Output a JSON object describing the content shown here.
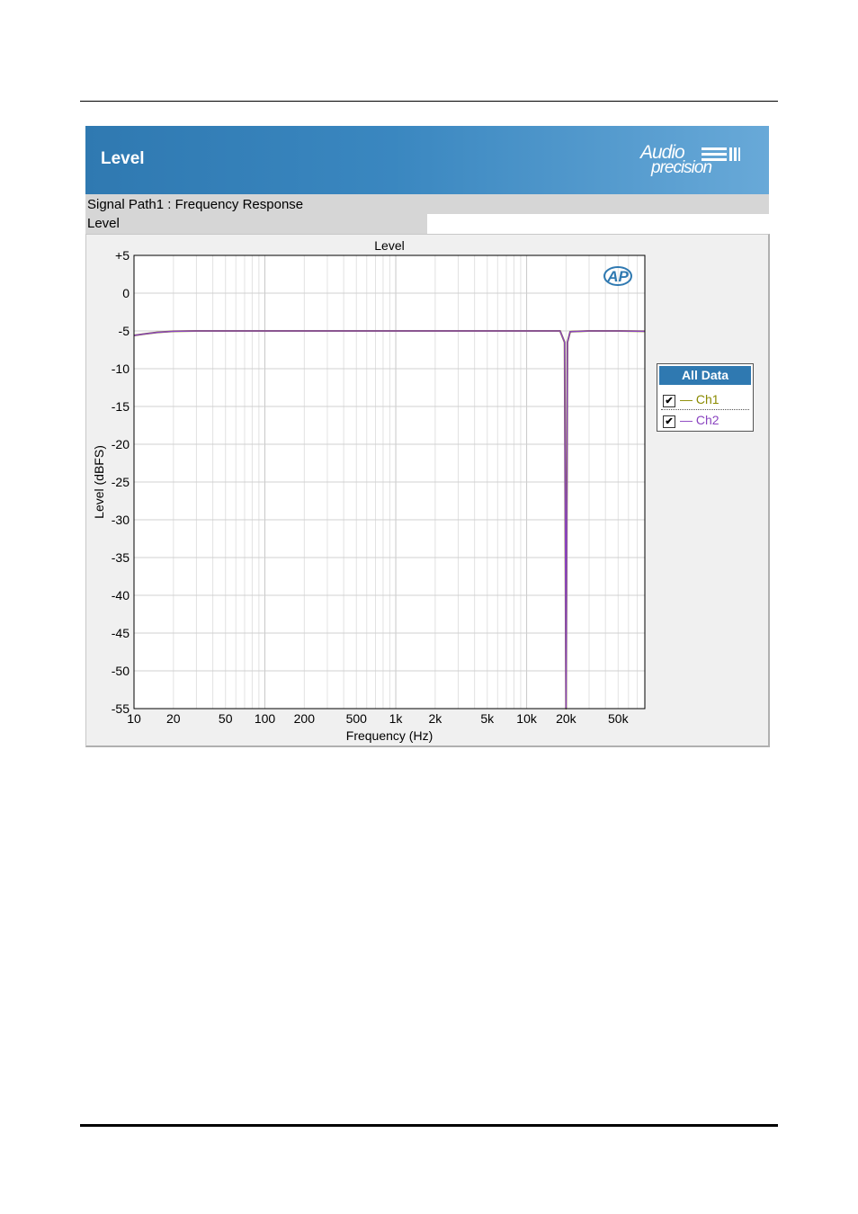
{
  "header": {
    "banner_title": "Level",
    "logo_text_1": "Audio",
    "logo_text_2": "precision",
    "signal_path": "Signal Path1 : Frequency Response",
    "measurement": "Level"
  },
  "legend": {
    "title": "All Data",
    "items": [
      {
        "label": "— Ch1",
        "color": "#8a8a00",
        "checked": true
      },
      {
        "label": "— Ch2",
        "color": "#8a44c0",
        "checked": true
      }
    ]
  },
  "watermark": "AP",
  "chart_data": {
    "type": "line",
    "title": "Level",
    "xlabel": "Frequency (Hz)",
    "ylabel": "Level (dBFS)",
    "x_scale": "log",
    "xlim": [
      10,
      80000
    ],
    "ylim": [
      -55,
      5
    ],
    "grid": true,
    "legend_position": "right",
    "x_ticks": [
      {
        "v": 10,
        "label": "10"
      },
      {
        "v": 20,
        "label": "20"
      },
      {
        "v": 50,
        "label": "50"
      },
      {
        "v": 100,
        "label": "100"
      },
      {
        "v": 200,
        "label": "200"
      },
      {
        "v": 500,
        "label": "500"
      },
      {
        "v": 1000,
        "label": "1k"
      },
      {
        "v": 2000,
        "label": "2k"
      },
      {
        "v": 5000,
        "label": "5k"
      },
      {
        "v": 10000,
        "label": "10k"
      },
      {
        "v": 20000,
        "label": "20k"
      },
      {
        "v": 50000,
        "label": "50k"
      }
    ],
    "y_ticks": [
      {
        "v": 5,
        "label": "+5"
      },
      {
        "v": 0,
        "label": "0"
      },
      {
        "v": -5,
        "label": "-5"
      },
      {
        "v": -10,
        "label": "-10"
      },
      {
        "v": -15,
        "label": "-15"
      },
      {
        "v": -20,
        "label": "-20"
      },
      {
        "v": -25,
        "label": "-25"
      },
      {
        "v": -30,
        "label": "-30"
      },
      {
        "v": -35,
        "label": "-35"
      },
      {
        "v": -40,
        "label": "-40"
      },
      {
        "v": -45,
        "label": "-45"
      },
      {
        "v": -50,
        "label": "-50"
      },
      {
        "v": -55,
        "label": "-55"
      }
    ],
    "series": [
      {
        "name": "Ch1",
        "color": "#8a8a00",
        "x": [
          10,
          12,
          15,
          20,
          30,
          50,
          100,
          1000,
          10000,
          18000,
          19500,
          20000,
          20500,
          21500,
          30000,
          50000,
          80000
        ],
        "y": [
          -5.6,
          -5.4,
          -5.2,
          -5.05,
          -5.0,
          -5.0,
          -5.0,
          -5.0,
          -5.0,
          -5.0,
          -6.5,
          -55,
          -6.5,
          -5.1,
          -5.0,
          -5.0,
          -5.05
        ]
      },
      {
        "name": "Ch2",
        "color": "#8a44c0",
        "x": [
          10,
          12,
          15,
          20,
          30,
          50,
          100,
          1000,
          10000,
          18000,
          19500,
          20000,
          20500,
          21500,
          30000,
          50000,
          80000
        ],
        "y": [
          -5.6,
          -5.4,
          -5.2,
          -5.05,
          -5.0,
          -5.0,
          -5.0,
          -5.0,
          -5.0,
          -5.0,
          -6.5,
          -55,
          -6.5,
          -5.1,
          -5.0,
          -5.0,
          -5.05
        ]
      }
    ]
  }
}
